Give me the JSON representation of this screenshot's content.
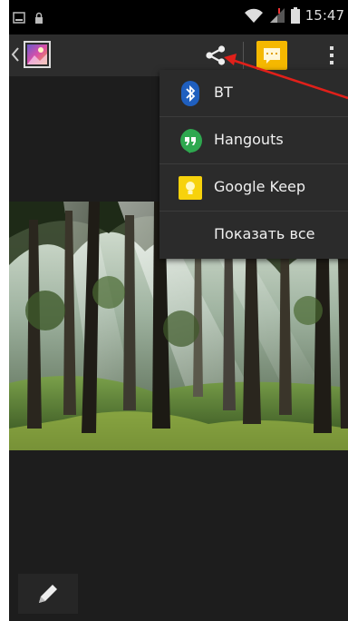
{
  "status_bar": {
    "time": "15:47"
  },
  "share_menu": {
    "items": [
      {
        "label": "BT",
        "icon": "bluetooth-icon"
      },
      {
        "label": "Hangouts",
        "icon": "hangouts-icon"
      },
      {
        "label": "Google Keep",
        "icon": "google-keep-icon"
      },
      {
        "label": "Показать все",
        "icon": ""
      }
    ]
  },
  "colors": {
    "screen_bg": "#1d1d1d",
    "action_bar": "#2d2d2d",
    "menu_bg": "#2b2b2b",
    "annotation_arrow": "#e0201a",
    "message_button": "#f5b800"
  }
}
